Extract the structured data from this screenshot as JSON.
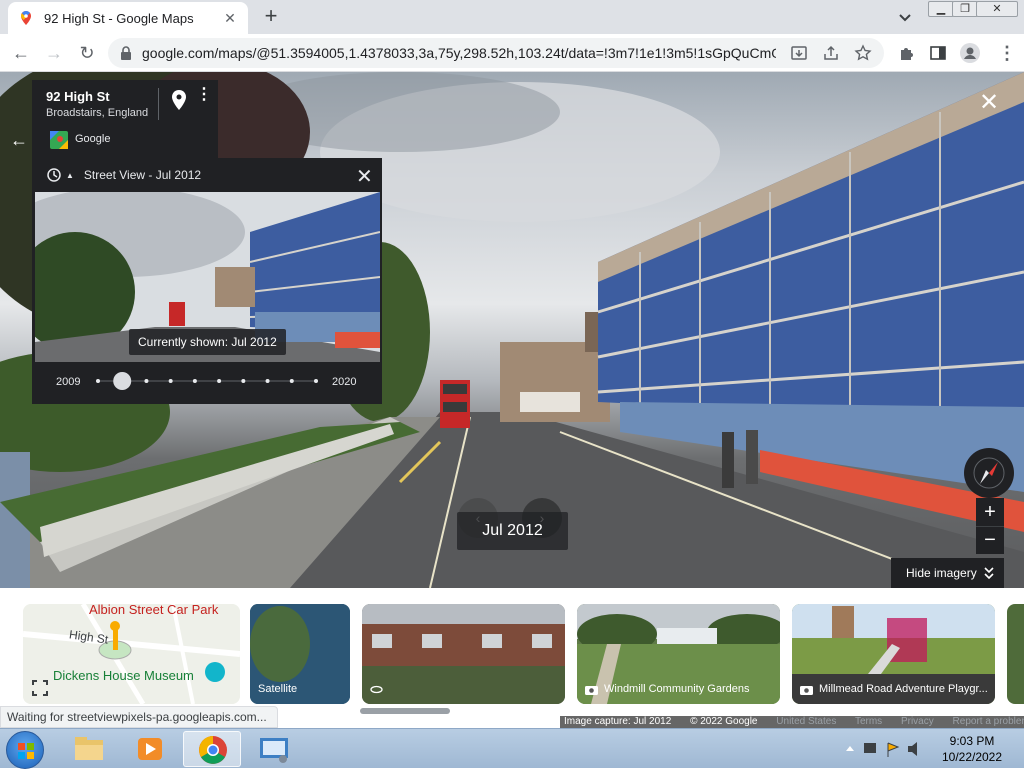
{
  "browser": {
    "tab_title": "92 High St - Google Maps",
    "url": "google.com/maps/@51.3594005,1.4378033,3a,75y,298.52h,103.24t/data=!3m7!1e1!3m5!1sGpQuCmO..."
  },
  "place_card": {
    "name": "92 High St",
    "locality": "Broadstairs, England",
    "attribution": "Google"
  },
  "time_machine": {
    "header": "Street View - Jul 2012",
    "currently_shown": "Currently shown: Jul 2012",
    "start_year": "2009",
    "end_year": "2020",
    "selected_index": 1,
    "stop_count": 10
  },
  "viewer": {
    "date_badge": "Jul 2012",
    "hide_imagery_label": "Hide imagery"
  },
  "filmstrip": {
    "map_labels": [
      "Albion Street Car Park",
      "High St",
      "Dickens House Museum"
    ],
    "satellite_label": "Satellite",
    "photos": [
      {
        "label": ""
      },
      {
        "label": "Windmill Community Gardens"
      },
      {
        "label": "Millmead Road Adventure Playgr..."
      }
    ]
  },
  "footer": {
    "capture": "Image capture: Jul 2012",
    "copyright": "© 2022 Google",
    "links": [
      "United States",
      "Terms",
      "Privacy",
      "Report a problem"
    ]
  },
  "status_bar": "Waiting for streetviewpixels-pa.googleapis.com...",
  "taskbar": {
    "time": "9:03 PM",
    "date": "10/22/2022"
  },
  "colors": {
    "panel_bg": "#202124",
    "accent_red": "#d32f2f"
  }
}
